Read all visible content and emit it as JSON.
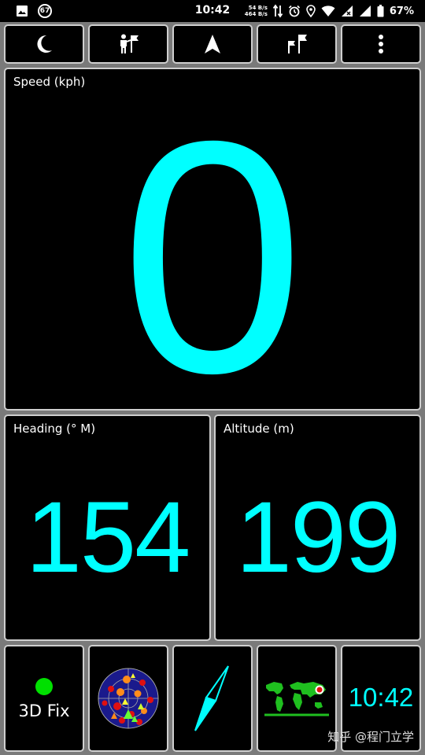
{
  "status_bar": {
    "time": "10:42",
    "notification_badge": "67",
    "rate_up": "54 B/s",
    "rate_down": "464 B/s",
    "battery": "67%",
    "icons": [
      "image-icon",
      "badge-icon",
      "data-transfer-icon",
      "alarm-icon",
      "location-icon",
      "wifi-icon",
      "signal-icon",
      "signal-icon",
      "battery-icon"
    ]
  },
  "toolbar": {
    "icons": [
      "moon-icon",
      "person-flag-icon",
      "navigation-arrow-icon",
      "flag-icon",
      "more-vert-icon"
    ]
  },
  "speed": {
    "label": "Speed (kph)",
    "value": "0"
  },
  "heading": {
    "label": "Heading (° M)",
    "value": "154"
  },
  "altitude": {
    "label": "Altitude (m)",
    "value": "199"
  },
  "bottom": {
    "fix_label": "3D Fix",
    "clock": "10:42",
    "icons": [
      "gps-fix-icon",
      "satellite-sky-icon",
      "compass-icon",
      "world-map-icon"
    ]
  },
  "watermark": "知乎 @程门立学",
  "colors": {
    "accent": "#00ffff",
    "fix_ok": "#00e000",
    "panel_bg": "#000000",
    "background": "#7a7a7a"
  }
}
